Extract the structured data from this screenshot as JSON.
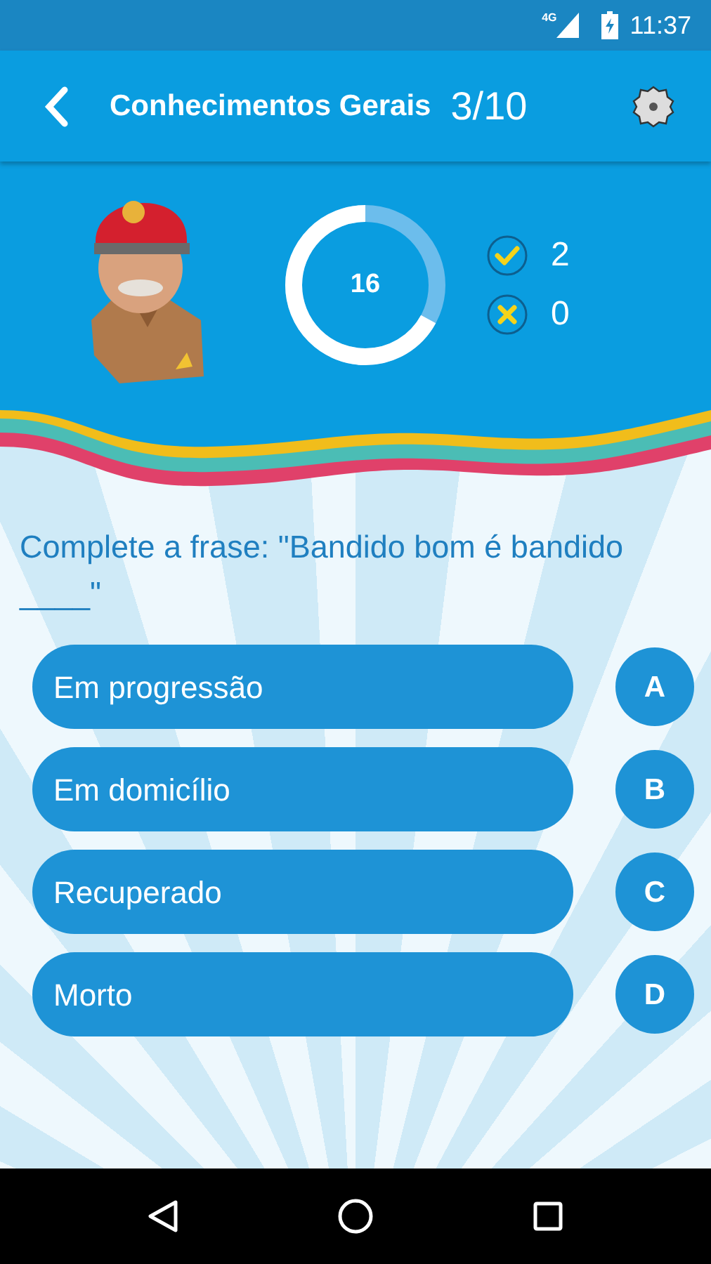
{
  "status_bar": {
    "network": "4G",
    "time": "11:37"
  },
  "app_bar": {
    "title": "Conhecimentos Gerais",
    "progress": "3/10"
  },
  "timer": {
    "value": "16"
  },
  "score": [
    {
      "kind": "correct",
      "count": "2"
    },
    {
      "kind": "wrong",
      "count": "0"
    }
  ],
  "question": "Complete a frase: \"Bandido bom é bandido ____\"",
  "answers": [
    {
      "text": "Em progressão",
      "letter": "A"
    },
    {
      "text": "Em domicílio",
      "letter": "B"
    },
    {
      "text": "Recuperado",
      "letter": "C"
    },
    {
      "text": "Morto",
      "letter": "D"
    }
  ]
}
